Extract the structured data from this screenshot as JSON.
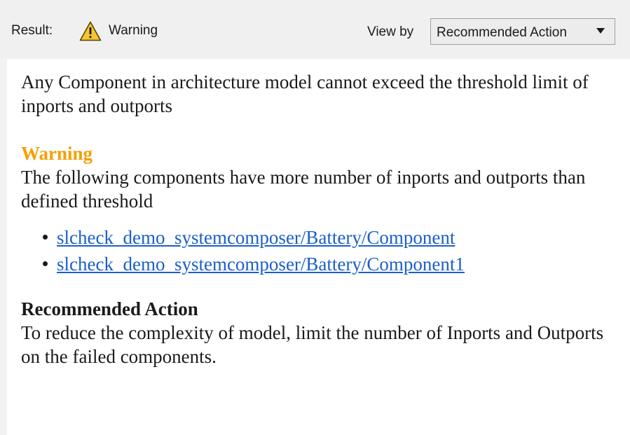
{
  "header": {
    "result_label": "Result:",
    "result_icon": "warning-triangle-icon",
    "result_value": "Warning",
    "viewby_label": "View by",
    "viewby_value": "Recommended Action"
  },
  "report": {
    "check_description": "Any Component in architecture model cannot exceed the threshold limit of inports and outports",
    "status_heading": "Warning",
    "status_description": "The following components have more number of inports and outports than defined threshold",
    "components": [
      "slcheck_demo_systemcomposer/Battery/Component",
      "slcheck_demo_systemcomposer/Battery/Component1"
    ],
    "action_heading": "Recommended Action",
    "action_text": "To reduce the complexity of model, limit the number of Inports and Outports on the failed components."
  },
  "colors": {
    "warning_heading": "#f5a000",
    "link": "#1b5fc9",
    "header_bg": "#f0f0f0"
  }
}
